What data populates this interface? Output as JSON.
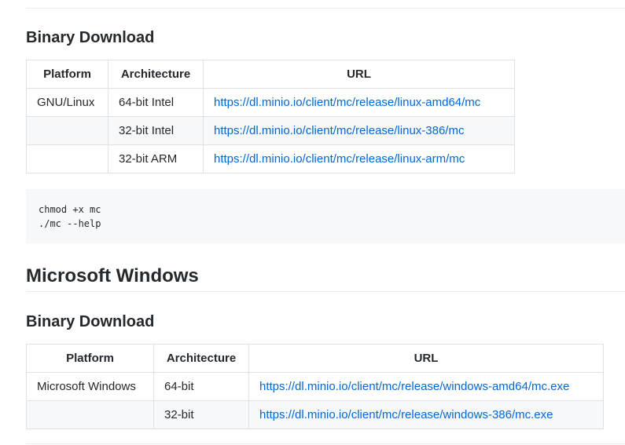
{
  "linux": {
    "subheading": "Binary Download",
    "table": {
      "headers": [
        "Platform",
        "Architecture",
        "URL"
      ],
      "rows": [
        [
          "GNU/Linux",
          "64-bit Intel",
          "https://dl.minio.io/client/mc/release/linux-amd64/mc"
        ],
        [
          "",
          "32-bit Intel",
          "https://dl.minio.io/client/mc/release/linux-386/mc"
        ],
        [
          "",
          "32-bit ARM",
          "https://dl.minio.io/client/mc/release/linux-arm/mc"
        ]
      ]
    },
    "code": [
      "chmod +x mc",
      "./mc --help"
    ]
  },
  "windows": {
    "heading": "Microsoft Windows",
    "subheading": "Binary Download",
    "table": {
      "headers": [
        "Platform",
        "Architecture",
        "URL"
      ],
      "rows": [
        [
          "Microsoft Windows",
          "64-bit",
          "https://dl.minio.io/client/mc/release/windows-amd64/mc.exe"
        ],
        [
          "",
          "32-bit",
          "https://dl.minio.io/client/mc/release/windows-386/mc.exe"
        ]
      ]
    }
  }
}
